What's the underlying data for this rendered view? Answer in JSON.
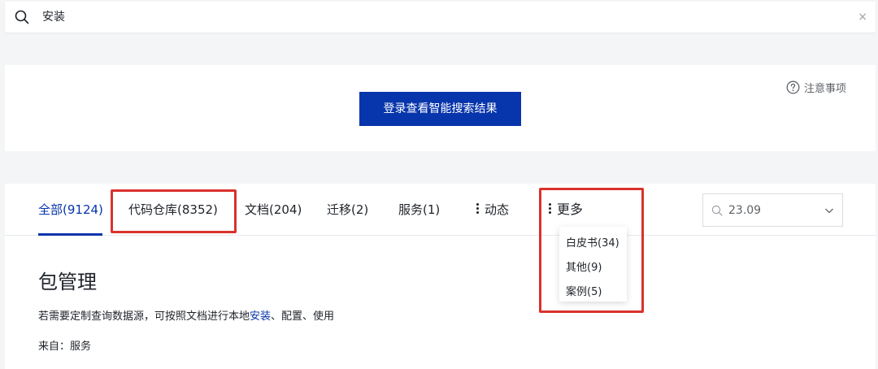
{
  "search": {
    "query": "安装",
    "clear_label": "×"
  },
  "login": {
    "button_label": "登录查看智能搜索结果",
    "notice_label": "注意事项"
  },
  "tabs": [
    {
      "label": "全部(9124)",
      "active": true
    },
    {
      "label": "代码仓库(8352)"
    },
    {
      "label": "文档(204)"
    },
    {
      "label": "迁移(2)"
    },
    {
      "label": "服务(1)"
    },
    {
      "label": "动态"
    },
    {
      "label": "更多"
    }
  ],
  "more_menu": {
    "items": [
      "白皮书(34)",
      "其他(9)",
      "案例(5)"
    ]
  },
  "version_filter": {
    "value": "23.09"
  },
  "result": {
    "title": "包管理",
    "desc_before": "若需要定制查询数据源，可按照文档进行本地",
    "desc_keyword": "安装",
    "desc_after": "、配置、使用",
    "source": "来自：服务"
  },
  "colors": {
    "accent": "#0735ab",
    "highlight": "#d9322c"
  },
  "icons": {
    "search": "search-icon",
    "help": "question-circle-icon",
    "more": "vertical-dots-icon",
    "chevron": "chevron-down-icon"
  }
}
